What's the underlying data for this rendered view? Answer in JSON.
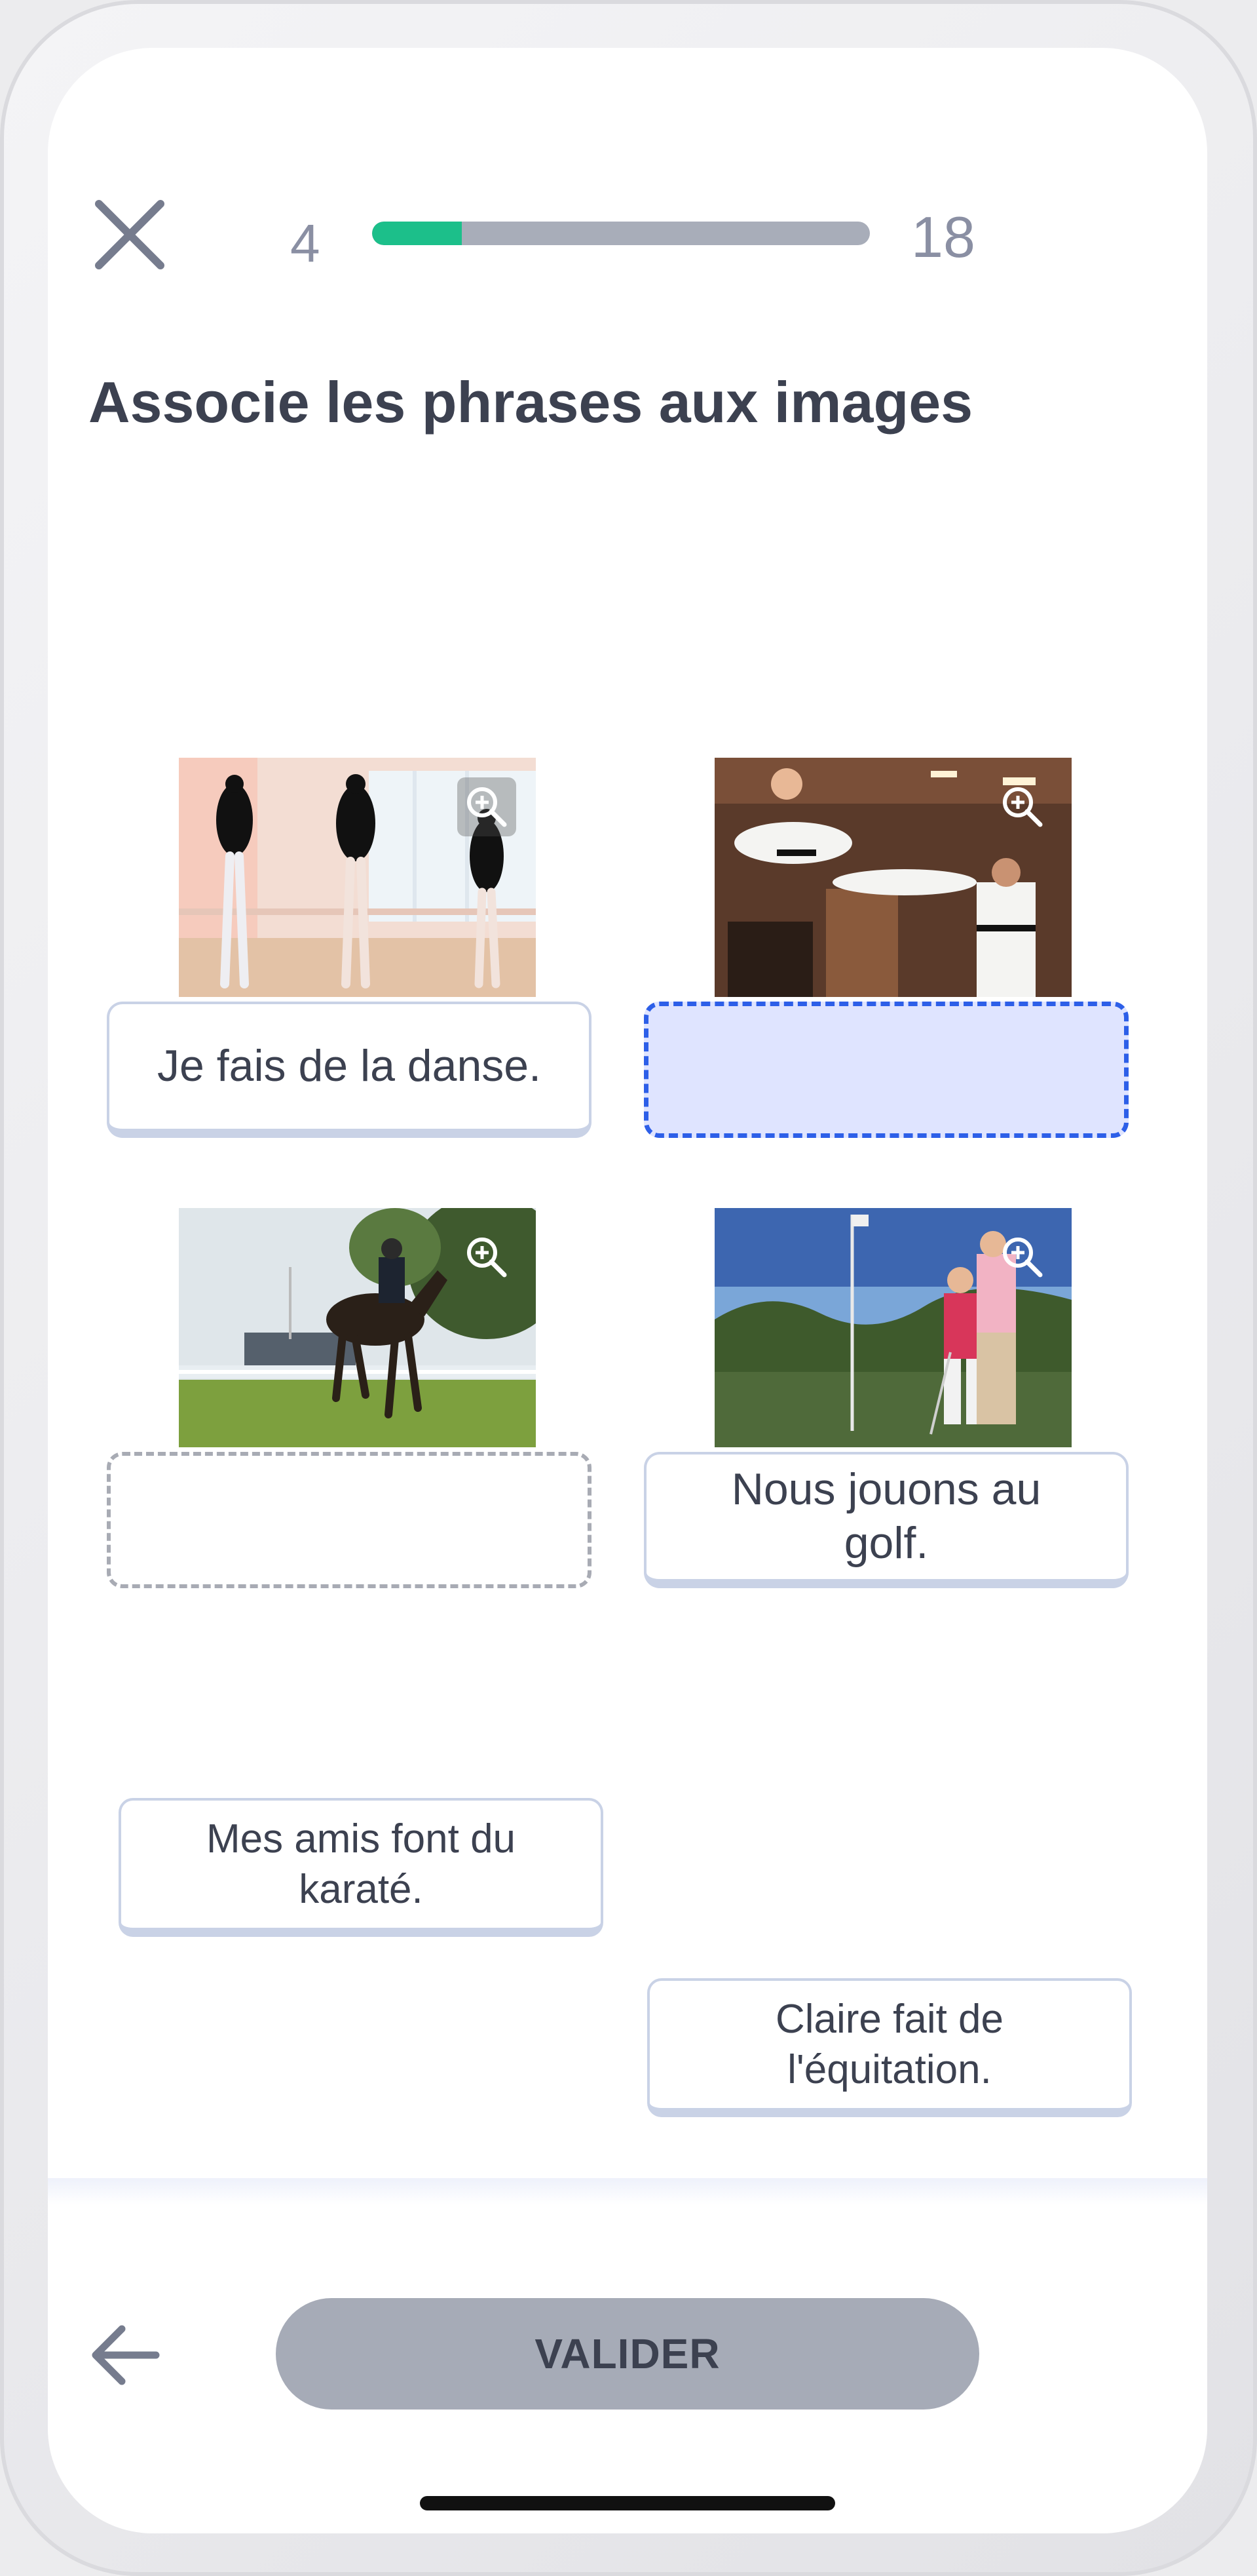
{
  "header": {
    "close_icon": "close-icon",
    "progress_current": "4",
    "progress_total": "18",
    "progress_fraction": 0.18,
    "accent_color": "#1cbf8a"
  },
  "title": "Associe les phrases aux images",
  "pairs": [
    {
      "image": "ballet-dancers",
      "slot_text": "Je fais de la danse.",
      "state": "filled"
    },
    {
      "image": "karate-kick",
      "slot_text": "",
      "state": "active"
    },
    {
      "image": "horse-rider",
      "slot_text": "",
      "state": "empty"
    },
    {
      "image": "golf-lesson",
      "slot_text": "Nous jouons au golf.",
      "state": "filled"
    }
  ],
  "options": [
    {
      "label": "Mes amis font du karaté."
    },
    {
      "label": "Claire fait de l'équitation."
    }
  ],
  "footer": {
    "back_icon": "arrow-left-icon",
    "validate_label": "VALIDER"
  },
  "colors": {
    "active_slot_border": "#2d5fe8",
    "active_slot_fill": "#dfe4ff",
    "button_disabled": "#a6abb7"
  }
}
